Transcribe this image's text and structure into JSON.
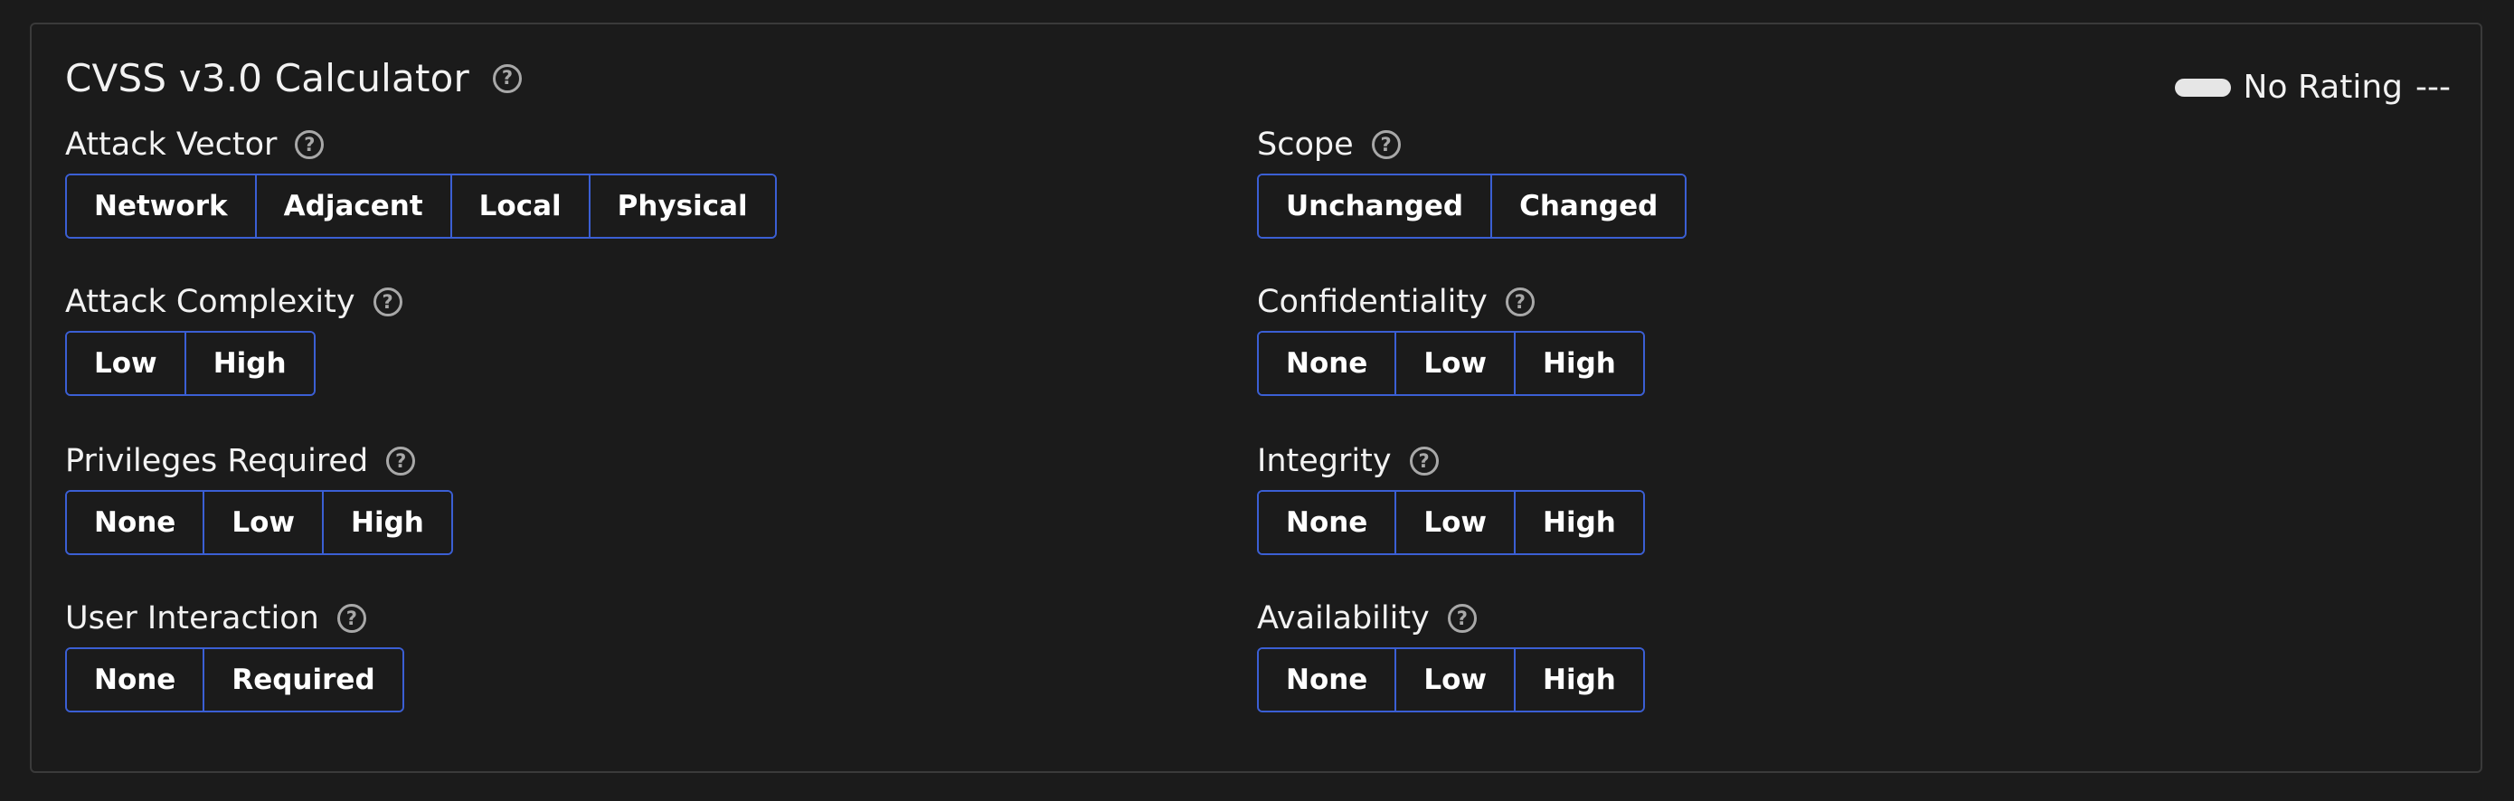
{
  "title": "CVSS v3.0 Calculator",
  "rating": {
    "label": "No Rating",
    "score": "---"
  },
  "metrics": {
    "attack_vector": {
      "label": "Attack Vector",
      "options": [
        "Network",
        "Adjacent",
        "Local",
        "Physical"
      ]
    },
    "attack_complexity": {
      "label": "Attack Complexity",
      "options": [
        "Low",
        "High"
      ]
    },
    "privileges_required": {
      "label": "Privileges Required",
      "options": [
        "None",
        "Low",
        "High"
      ]
    },
    "user_interaction": {
      "label": "User Interaction",
      "options": [
        "None",
        "Required"
      ]
    },
    "scope": {
      "label": "Scope",
      "options": [
        "Unchanged",
        "Changed"
      ]
    },
    "confidentiality": {
      "label": "Confidentiality",
      "options": [
        "None",
        "Low",
        "High"
      ]
    },
    "integrity": {
      "label": "Integrity",
      "options": [
        "None",
        "Low",
        "High"
      ]
    },
    "availability": {
      "label": "Availability",
      "options": [
        "None",
        "Low",
        "High"
      ]
    }
  },
  "colors": {
    "background": "#1b1b1b",
    "button_border": "#3b5fd4",
    "help_icon": "#a8a8a8",
    "rating_pill": "#e6e6e6"
  },
  "icons": {
    "help": "help-circle-icon",
    "rating": "rating-pill-icon"
  }
}
